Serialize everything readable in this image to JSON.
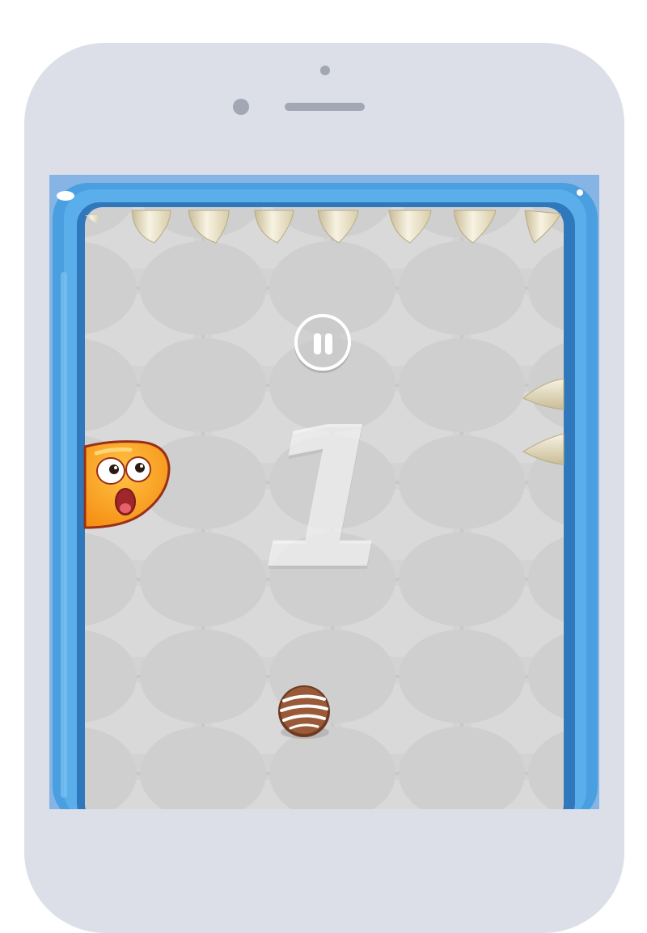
{
  "game": {
    "score": "1",
    "pause_icon": "pause-icon",
    "player_character": "orange-jelly-blob",
    "collectible": "chocolate-candy",
    "hazards": "spikes"
  },
  "colors": {
    "frame_blue": "#4a9fe0",
    "arena_gray": "#c9c9c9",
    "jelly_orange": "#f8a21a",
    "jelly_outline": "#9a2f17",
    "candy_brown": "#9a5a37",
    "spike_ivory": "#efe8d2"
  }
}
